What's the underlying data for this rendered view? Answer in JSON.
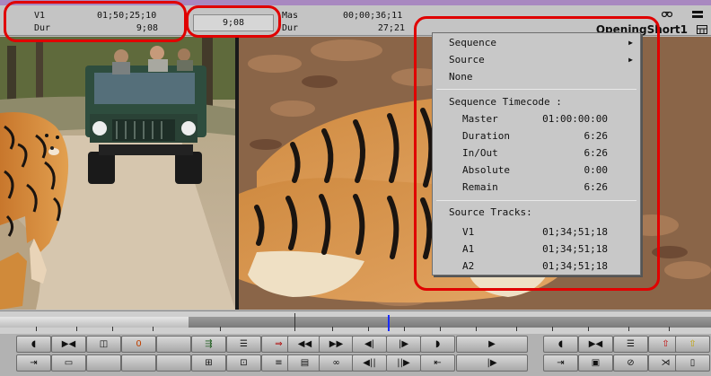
{
  "source_monitor": {
    "track_label": "V1",
    "track_timecode": "01;50;25;10",
    "dur_label": "Dur",
    "dur_value": "9;08"
  },
  "center_display": "9;08",
  "record_monitor": {
    "master_label": "Mas",
    "master_timecode": "00;00;36;11",
    "dur_label": "Dur",
    "dur_value": "27;21",
    "sequence_name": "OpeningShort1"
  },
  "context_menu": {
    "items": [
      {
        "label": "Sequence",
        "has_submenu": true
      },
      {
        "label": "Source",
        "has_submenu": true
      },
      {
        "label": "None",
        "has_submenu": false
      }
    ],
    "sequence_timecode_header": "Sequence Timecode :",
    "sequence_rows": [
      {
        "label": "Master",
        "value": "01:00:00:00"
      },
      {
        "label": "Duration",
        "value": "6:26"
      },
      {
        "label": "In/Out",
        "value": "6:26"
      },
      {
        "label": "Absolute",
        "value": "0:00"
      },
      {
        "label": "Remain",
        "value": "6:26"
      }
    ],
    "source_tracks_header": "Source Tracks:",
    "track_rows": [
      {
        "label": "V1",
        "value": "01;34;51;18"
      },
      {
        "label": "A1",
        "value": "01;34;51;18"
      },
      {
        "label": "A2",
        "value": "01;34;51;18"
      }
    ]
  },
  "timeline": {
    "playhead_fraction": 0.545
  },
  "toolbar": {
    "source_row1": [
      "mark-in",
      "mark-out",
      "mark-clip",
      "clear-marks",
      "",
      "splice-in",
      "lift",
      "overwrite"
    ],
    "mark_count_label": "0",
    "source_row2": [
      "go-to-in",
      "play-loop",
      "",
      "",
      "",
      "source-monitor",
      "record-monitor",
      "adjust"
    ],
    "transport_row1": [
      "rewind",
      "fast-forward",
      "step-back",
      "step-forward",
      "play-reverse",
      "play"
    ],
    "transport_row2": [
      "grid",
      "loop-view",
      "prev-edit",
      "next-edit",
      "go-to-out",
      "go-to-start"
    ],
    "record_row1": [
      "mark-in",
      "mark-out",
      "mark-clip",
      "red-arrow",
      "yellow-arrow"
    ],
    "record_row2": [
      "go-to-mark",
      "add-edit",
      "no-sign",
      "split",
      "clipboard"
    ]
  },
  "colors": {
    "annotation": "#e00000",
    "menu_bg": "#c8c8c8",
    "header_bg": "#c4c4c4",
    "playhead": "#1a2cff",
    "accent_purple": "#a888c0"
  }
}
